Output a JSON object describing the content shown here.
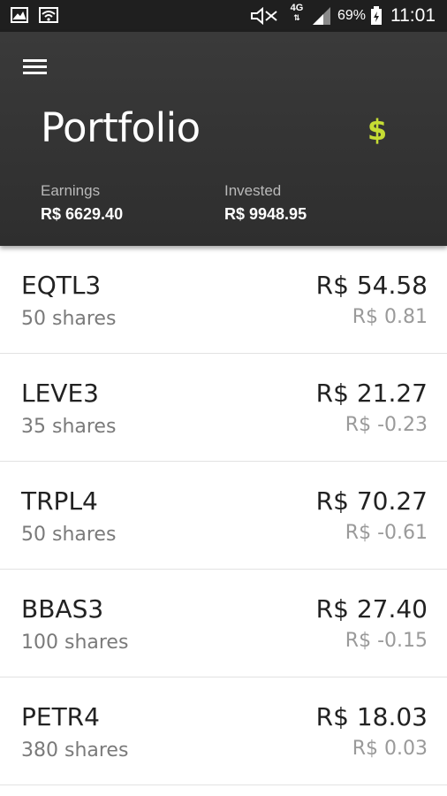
{
  "status_bar": {
    "network": "4G",
    "battery_percent": "69%",
    "time": "11:01",
    "icons": [
      "gallery-icon",
      "wifi-icon",
      "mute-icon",
      "network-4g-icon",
      "signal-icon",
      "battery-icon"
    ]
  },
  "header": {
    "title": "Portfolio",
    "currency_symbol": "$",
    "earnings_label": "Earnings",
    "earnings_value": "R$ 6629.40",
    "invested_label": "Invested",
    "invested_value": "R$ 9948.95"
  },
  "stocks": [
    {
      "ticker": "EQTL3",
      "shares": "50 shares",
      "price": "R$ 54.58",
      "change": "R$ 0.81"
    },
    {
      "ticker": "LEVE3",
      "shares": "35 shares",
      "price": "R$ 21.27",
      "change": "R$ -0.23"
    },
    {
      "ticker": "TRPL4",
      "shares": "50 shares",
      "price": "R$ 70.27",
      "change": "R$ -0.61"
    },
    {
      "ticker": "BBAS3",
      "shares": "100 shares",
      "price": "R$ 27.40",
      "change": "R$ -0.15"
    },
    {
      "ticker": "PETR4",
      "shares": "380 shares",
      "price": "R$ 18.03",
      "change": "R$ 0.03"
    }
  ],
  "colors": {
    "accent": "#c6dd34",
    "header_bg": "#333333",
    "statusbar_bg": "#1f1f1f"
  }
}
